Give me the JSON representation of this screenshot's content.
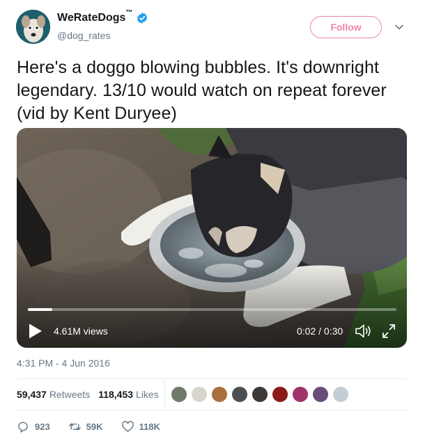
{
  "user": {
    "display_name": "WeRateDogs",
    "trademark": "™",
    "handle": "@dog_rates",
    "avatar": "dog-face-avatar",
    "verified": true
  },
  "header": {
    "follow_label": "Follow",
    "menu_icon": "chevron-down-icon"
  },
  "tweet": {
    "text": "Here's a doggo blowing bubbles. It's downright legendary. 13/10 would watch on repeat forever (vid by Kent Duryee)"
  },
  "video": {
    "views": "4.61M views",
    "time": "0:02 / 0:30",
    "progress": 0.067,
    "play_icon": "play-icon",
    "volume_icon": "volume-icon",
    "fullscreen_icon": "fullscreen-icon"
  },
  "timestamp": "4:31 PM - 4 Jun 2016",
  "stats": {
    "retweets_count": "59,437",
    "retweets_label": "Retweets",
    "likes_count": "118,453",
    "likes_label": "Likes",
    "liker_avatars": [
      "#6f7a6a",
      "#d9d6cc",
      "#a8703d",
      "#4b4f52",
      "#3e3a38",
      "#8b1a1a",
      "#a0346a",
      "#6b4d7a",
      "#c4ccd4"
    ]
  },
  "actions": {
    "reply_count": "923",
    "retweet_count": "59K",
    "like_count": "118K"
  },
  "colors": {
    "follow": "#e0245e",
    "verified": "#1da1f2",
    "secondary_text": "#657786"
  }
}
